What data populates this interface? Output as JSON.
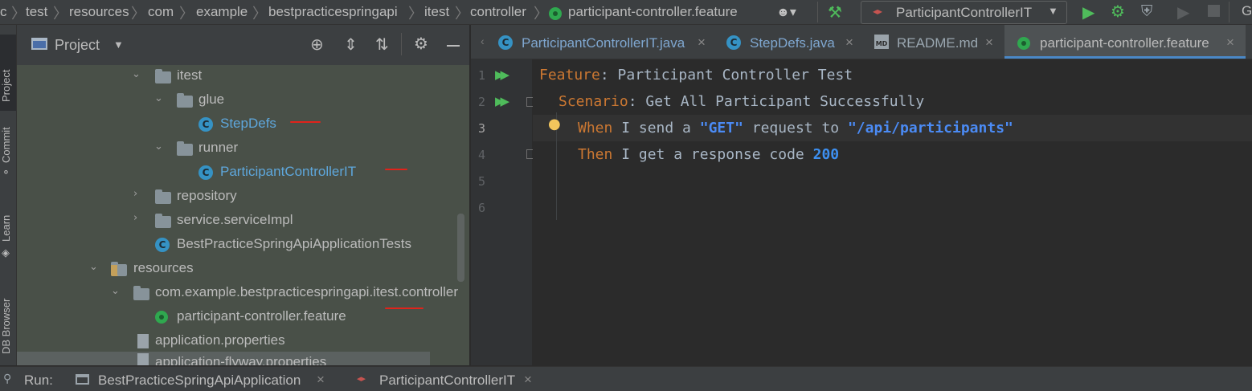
{
  "breadcrumb": {
    "items": [
      "c",
      "test",
      "resources",
      "com",
      "example",
      "bestpracticespringapi",
      "itest",
      "controller",
      "participant-controller.feature"
    ]
  },
  "toolbar": {
    "run_config": "ParticipantControllerIT"
  },
  "sidebar_strip": {
    "items": [
      "Project",
      "Commit",
      "Learn",
      "DB Browser"
    ]
  },
  "project_panel": {
    "title": "Project",
    "tree": [
      {
        "label": "itest",
        "type": "folder"
      },
      {
        "label": "glue",
        "type": "folder"
      },
      {
        "label": "StepDefs",
        "type": "class"
      },
      {
        "label": "runner",
        "type": "folder"
      },
      {
        "label": "ParticipantControllerIT",
        "type": "class"
      },
      {
        "label": "repository",
        "type": "folder"
      },
      {
        "label": "service.serviceImpl",
        "type": "folder"
      },
      {
        "label": "BestPracticeSpringApiApplicationTests",
        "type": "class"
      },
      {
        "label": "resources",
        "type": "resources-folder"
      },
      {
        "label": "com.example.bestpracticespringapi.itest.controller",
        "type": "folder"
      },
      {
        "label": "participant-controller.feature",
        "type": "feature"
      },
      {
        "label": "application.properties",
        "type": "properties"
      },
      {
        "label": "application-flyway.properties",
        "type": "properties"
      }
    ]
  },
  "editor": {
    "tabs": [
      {
        "label": "ParticipantControllerIT.java",
        "icon": "class-icon"
      },
      {
        "label": "StepDefs.java",
        "icon": "class-icon"
      },
      {
        "label": "README.md",
        "icon": "markdown-icon"
      },
      {
        "label": "participant-controller.feature",
        "icon": "cucumber-icon",
        "active": true
      }
    ],
    "line_numbers": [
      "1",
      "2",
      "3",
      "4",
      "5",
      "6"
    ],
    "lines": {
      "l1_kw": "Feature",
      "l1_rest": ": Participant Controller Test",
      "l2_kw": "Scenario",
      "l2_rest": ": Get All Participant Successfully",
      "l3_kw": "When",
      "l3_a": " I send a ",
      "l3_s1": "\"GET\"",
      "l3_b": " request to ",
      "l3_s2": "\"/api/participants\"",
      "l4_kw": "Then",
      "l4_a": " I get a response code ",
      "l4_num": "200"
    }
  },
  "bottom_bar": {
    "run_label": "Run:",
    "tabs": [
      "BestPracticeSpringApiApplication",
      "ParticipantControllerIT"
    ]
  },
  "colors": {
    "accent_green": "#4fbc5b",
    "keyword": "#cc7832",
    "string": "#4b8bf5",
    "annotation_red": "#e0231b"
  }
}
